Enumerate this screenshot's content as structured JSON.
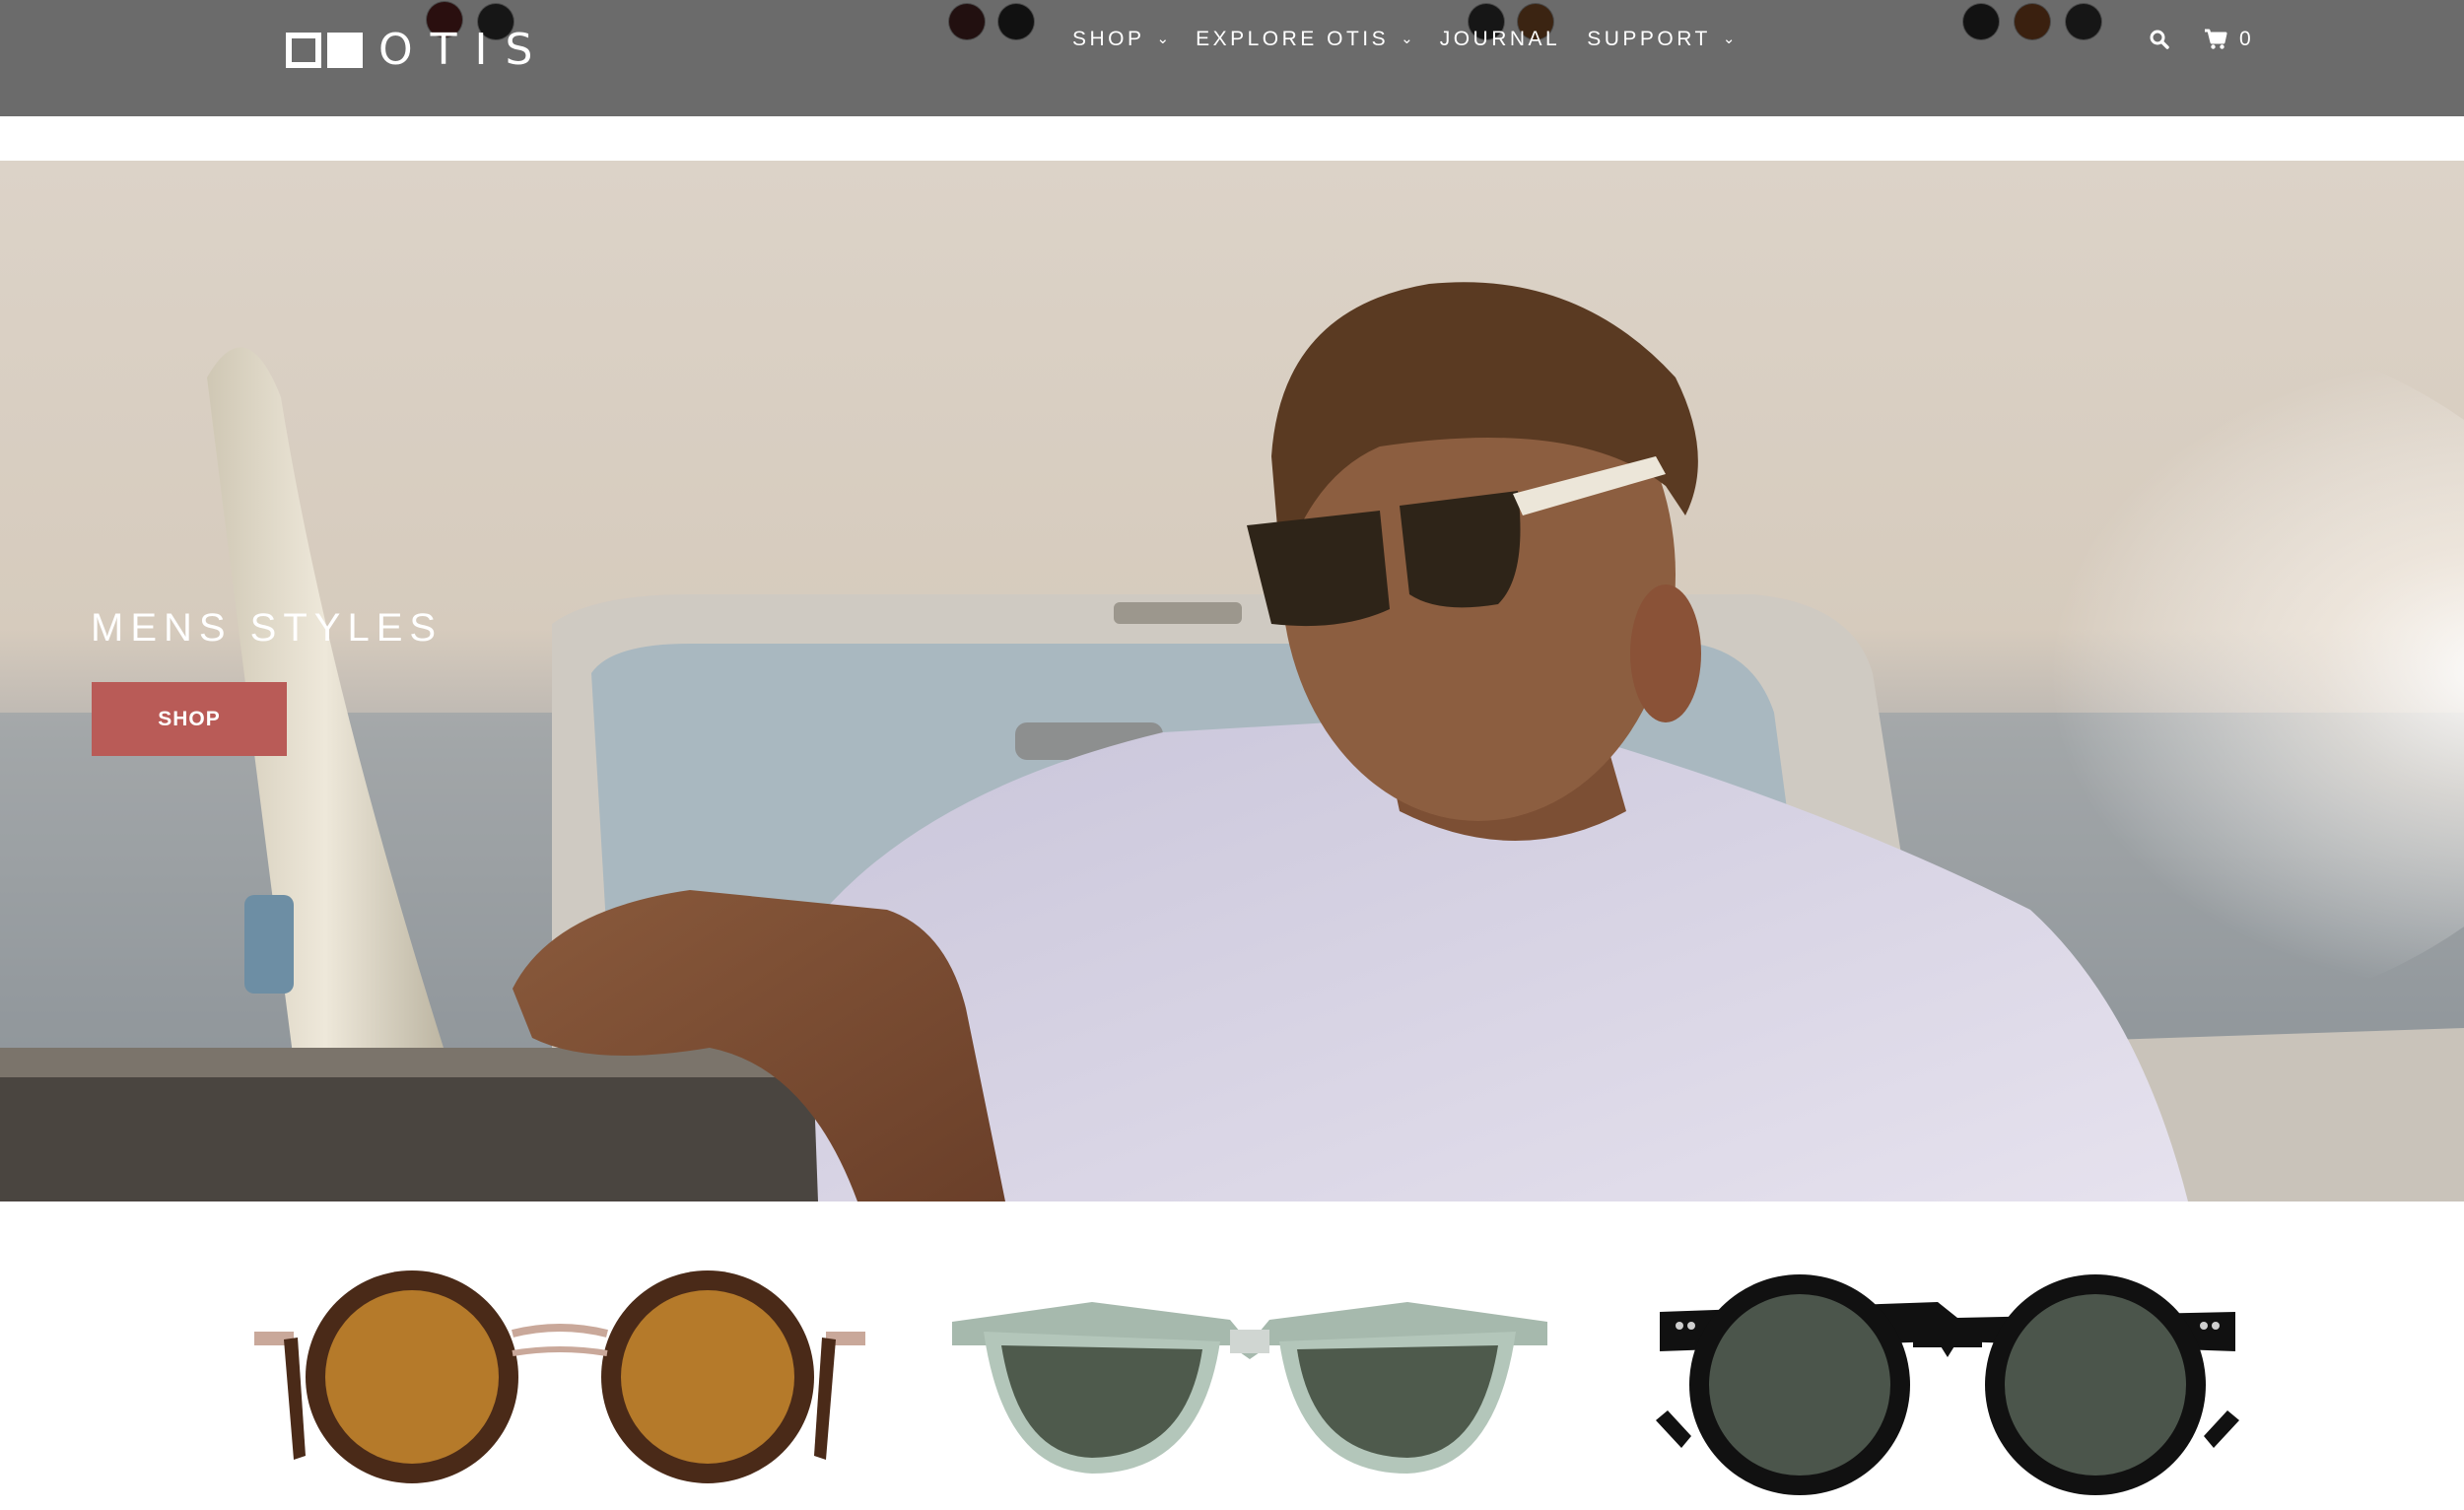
{
  "brand": {
    "name": "OTIS",
    "logo_icon": "two-squares-logo"
  },
  "nav": {
    "items": [
      {
        "label": "SHOP",
        "has_dropdown": true
      },
      {
        "label": "EXPLORE OTIS",
        "has_dropdown": true
      },
      {
        "label": "JOURNAL",
        "has_dropdown": false
      },
      {
        "label": "SUPPORT",
        "has_dropdown": true
      }
    ],
    "chevron": "⌄"
  },
  "utility": {
    "search_icon": "search-icon",
    "cart_icon": "cart-icon",
    "cart_count": "0"
  },
  "hero": {
    "title": "MENS STYLES",
    "button_label": "SHOP",
    "button_color": "#b95b57"
  },
  "colors": {
    "header_bg": "#6b6b6b",
    "accent": "#b95b57"
  },
  "products": [
    {
      "name": "tortoise-round-sunglasses",
      "frame_color": "#4a2a18",
      "lens_color": "#b57a2a"
    },
    {
      "name": "clear-sage-round-sunglasses",
      "frame_color": "#9fb3a8",
      "lens_color": "#4e5a4c"
    },
    {
      "name": "black-round-sunglasses",
      "frame_color": "#111111",
      "lens_color": "#4b554b"
    }
  ]
}
